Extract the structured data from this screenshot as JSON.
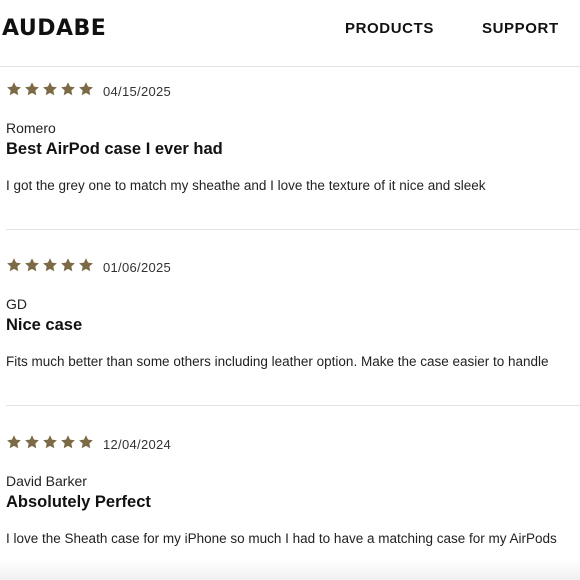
{
  "header": {
    "logo": "AUDABE",
    "nav": [
      "PRODUCTS",
      "SUPPORT"
    ]
  },
  "colors": {
    "star": "#7b6a45",
    "divider": "#e2e2e2"
  },
  "reviews": [
    {
      "rating": 5,
      "date": "04/15/2025",
      "author": "Romero",
      "title": "Best AirPod case I ever had",
      "body": "I got the grey one to match my sheathe and I love the texture of it nice and sleek"
    },
    {
      "rating": 5,
      "date": "01/06/2025",
      "author": "GD",
      "title": "Nice case",
      "body": "Fits much better than some others including leather option. Make the case easier to handle"
    },
    {
      "rating": 5,
      "date": "12/04/2024",
      "author": "David Barker",
      "title": "Absolutely Perfect",
      "body": "I love the Sheath case for my iPhone so much I had to have a matching case for my AirPods"
    }
  ]
}
